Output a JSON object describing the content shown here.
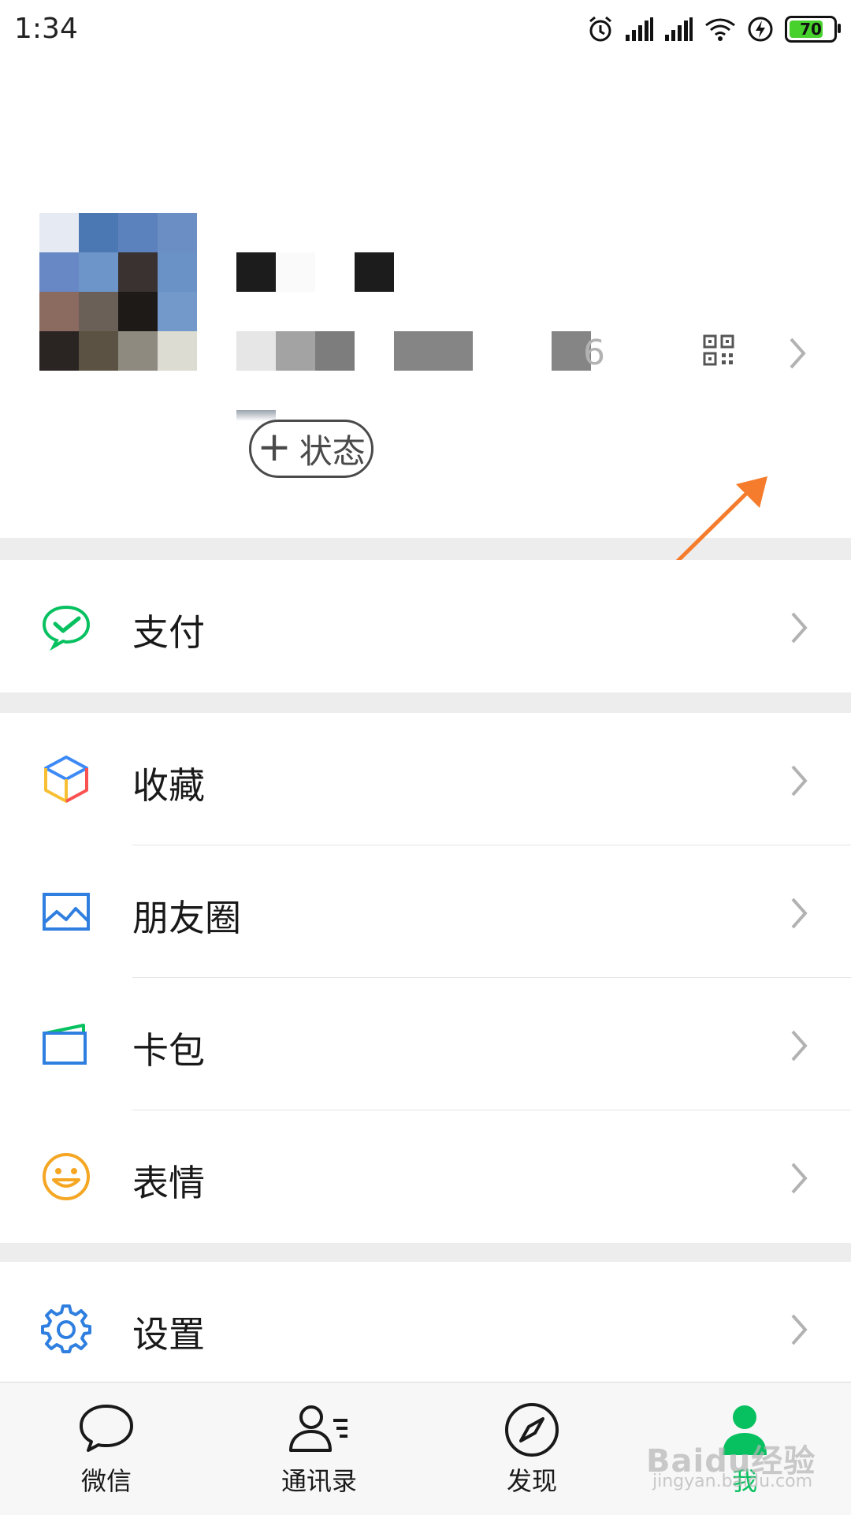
{
  "status_bar": {
    "time": "1:34",
    "battery": "70"
  },
  "profile": {
    "wxid_tail": "6",
    "status_button": {
      "plus": "+",
      "label": "状态"
    }
  },
  "menu": {
    "pay": "支付",
    "favorites": "收藏",
    "moments": "朋友圈",
    "cards": "卡包",
    "stickers": "表情",
    "settings": "设置"
  },
  "tabbar": {
    "tabs": [
      {
        "label": "微信"
      },
      {
        "label": "通讯录"
      },
      {
        "label": "发现"
      },
      {
        "label": "我"
      }
    ],
    "active_index": 3
  },
  "watermark": {
    "brand": "Baidu经验",
    "url": "jingyan.baidu.com"
  },
  "colors": {
    "accent": "#07c160",
    "arrow": "#f57c2c",
    "background": "#ededed"
  }
}
